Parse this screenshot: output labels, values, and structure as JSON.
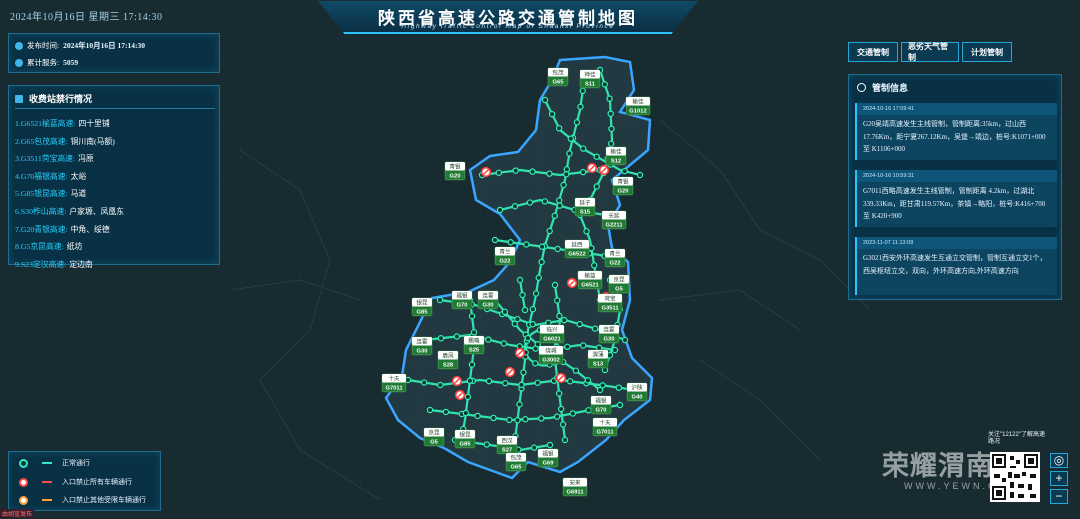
{
  "header": {
    "datetime": "2024年10月16日 星期三 17:14:30",
    "title": "陕西省高速公路交通管制地图",
    "subtitle": "Highway traffic control map of Shaanxi Province"
  },
  "info": {
    "publish_label": "发布时间:",
    "publish_value": "2024年10月16日 17:14:30",
    "service_label": "累计服务:",
    "service_value": "5059"
  },
  "toll": {
    "title": "收费站禁行情况",
    "items": [
      {
        "road": "1.G6521榆蓝高速:",
        "station": "四十里铺"
      },
      {
        "road": "2.G65包茂高速:",
        "station": "铜川南(马额)"
      },
      {
        "road": "3.G3511菏宝高速:",
        "station": "冯原"
      },
      {
        "road": "4.G70福银高速:",
        "station": "太峪"
      },
      {
        "road": "5.G85银昆高速:",
        "station": "马道"
      },
      {
        "road": "6.S30柞山高速:",
        "station": "户家塬、凤凰东"
      },
      {
        "road": "7.G20青银高速:",
        "station": "中角、绥德"
      },
      {
        "road": "8.G5京昆高速:",
        "station": "纸坊"
      },
      {
        "road": "9.S23定汉高速:",
        "station": "定边南"
      }
    ]
  },
  "legend": {
    "items": [
      {
        "label": "正常通行",
        "color": "#2ee6c8"
      },
      {
        "label": "入口禁止所有车辆通行",
        "color": "#ff4a4a"
      },
      {
        "label": "入口禁止其他受限车辆通行",
        "color": "#ffa23a"
      }
    ]
  },
  "tabs": [
    "交通管制",
    "恶劣天气管制",
    "计划管制"
  ],
  "control": {
    "title": "管制信息",
    "notices": [
      {
        "time": "2024-10-16 17:09:41",
        "text": "G20吴靖高速发生主线管制，管制距离:35km，过山西17.76Km，距宁夏267.12Km，吴堡→靖边，桩号:K1071+000 至 K1106+000"
      },
      {
        "time": "2024-10-16 10:59:31",
        "text": "G7011西略高速发生主线管制，管制距离 4.2km，过湖北339.33Km，距甘肃119.57Km，茶镇→略阳，桩号:K416+700 至 K420+900"
      },
      {
        "time": "2023-11-07 11:13:08",
        "text": "G3021西安外环高速发生互通立交管制，管制互通立交1个，西吴枢纽立交，双向，外环高速方向,外环高速方向"
      }
    ]
  },
  "shields": [
    {
      "name": "包茂",
      "code": "G65"
    },
    {
      "name": "神佳",
      "code": "S11"
    },
    {
      "name": "榆佳",
      "code": "G1012"
    },
    {
      "name": "榆佳",
      "code": "S12"
    },
    {
      "name": "青银",
      "code": "G20"
    },
    {
      "name": "青银",
      "code": "G20"
    },
    {
      "name": "延子",
      "code": "S15"
    },
    {
      "name": "长延",
      "code": "G2211"
    },
    {
      "name": "延西",
      "code": "G6522"
    },
    {
      "name": "青兰",
      "code": "G22"
    },
    {
      "name": "青兰",
      "code": "G22"
    },
    {
      "name": "榆蓝",
      "code": "G6521"
    },
    {
      "name": "京昆",
      "code": "G5"
    },
    {
      "name": "菏宝",
      "code": "G3511"
    },
    {
      "name": "银昆",
      "code": "G85"
    },
    {
      "name": "福银",
      "code": "G70"
    },
    {
      "name": "连霍",
      "code": "G30"
    },
    {
      "name": "临兴",
      "code": "G6021"
    },
    {
      "name": "连霍",
      "code": "G30"
    },
    {
      "name": "绕城",
      "code": "G3002"
    },
    {
      "name": "鹏略",
      "code": "S25"
    },
    {
      "name": "连霍",
      "code": "G30"
    },
    {
      "name": "眉凤",
      "code": "S28"
    },
    {
      "name": "渭蒲",
      "code": "S13"
    },
    {
      "name": "十天",
      "code": "G7011"
    },
    {
      "name": "沪陕",
      "code": "G40"
    },
    {
      "name": "福银",
      "code": "G70"
    },
    {
      "name": "十天",
      "code": "G7011"
    },
    {
      "name": "京昆",
      "code": "G5"
    },
    {
      "name": "银昆",
      "code": "G85"
    },
    {
      "name": "西汉",
      "code": "S27"
    },
    {
      "name": "包茂",
      "code": "G65"
    },
    {
      "name": "福银",
      "code": "G69"
    },
    {
      "name": "安来",
      "code": "G6911"
    }
  ],
  "watermark": {
    "main": "荣耀渭南",
    "sub": "WWW.YEWN.COM"
  },
  "follow_text": "关注\"12122\"了解高速路况",
  "zoom": {
    "locate": "◎",
    "plus": "+",
    "minus": "−"
  },
  "credit": "由胡宣发布"
}
